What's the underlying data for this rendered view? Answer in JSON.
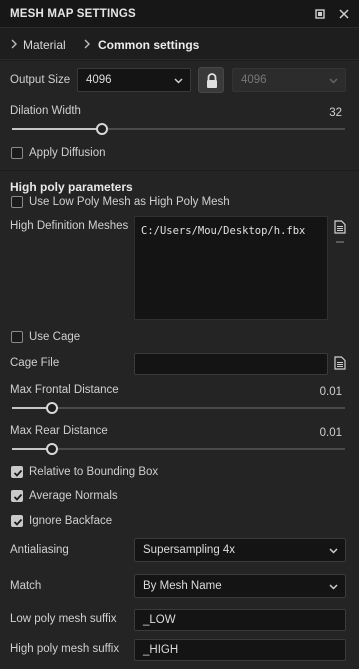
{
  "window": {
    "title": "MESH MAP SETTINGS"
  },
  "breadcrumb": {
    "item1": "Material",
    "item2": "Common settings"
  },
  "output_size": {
    "label": "Output Size",
    "value": "4096",
    "linked_value": "4096"
  },
  "dilation": {
    "label": "Dilation Width",
    "value": "32",
    "level": 0.27
  },
  "apply_diffusion": {
    "label": "Apply Diffusion",
    "checked": false
  },
  "high_poly": {
    "header": "High poly parameters",
    "use_low_poly": {
      "label": "Use Low Poly Mesh as High Poly Mesh",
      "checked": false
    },
    "meshes_label": "High Definition Meshes",
    "meshes": [
      "C:/Users/Mou/Desktop/h.fbx"
    ]
  },
  "use_cage": {
    "label": "Use Cage",
    "checked": false
  },
  "cage_file": {
    "label": "Cage File",
    "value": ""
  },
  "max_frontal": {
    "label": "Max Frontal Distance",
    "value": "0.01",
    "level": 0.12
  },
  "max_rear": {
    "label": "Max Rear Distance",
    "value": "0.01",
    "level": 0.12
  },
  "relative_bbox": {
    "label": "Relative to Bounding Box",
    "checked": true
  },
  "average_normals": {
    "label": "Average Normals",
    "checked": true
  },
  "ignore_backface": {
    "label": "Ignore Backface",
    "checked": true
  },
  "antialiasing": {
    "label": "Antialiasing",
    "value": "Supersampling 4x"
  },
  "match": {
    "label": "Match",
    "value": "By Mesh Name"
  },
  "low_suffix": {
    "label": "Low poly mesh suffix",
    "value": "_LOW"
  },
  "high_suffix": {
    "label": "High poly mesh suffix",
    "value": "_HIGH"
  }
}
